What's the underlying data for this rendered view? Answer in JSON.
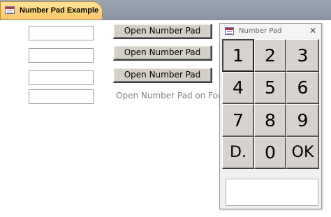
{
  "tab": {
    "title": "Number Pad Example",
    "icon": "form-icon"
  },
  "form": {
    "fields": [
      {
        "value": ""
      },
      {
        "value": ""
      },
      {
        "value": ""
      },
      {
        "value": ""
      }
    ],
    "buttons": [
      {
        "label": "Open Number Pad"
      },
      {
        "label": "Open Number Pad"
      },
      {
        "label": "Open Number Pad"
      }
    ],
    "focus_label": "Open Number Pad on Focus"
  },
  "numpad": {
    "title": "Number Pad",
    "icon": "form-icon",
    "close_glyph": "✕",
    "keys": [
      "1",
      "2",
      "3",
      "4",
      "5",
      "6",
      "7",
      "8",
      "9",
      "D.",
      "0",
      "OK"
    ],
    "selected_key": "1",
    "display_value": ""
  },
  "colors": {
    "tab_accent": "#f7c764",
    "tab_bar": "#9da6b3",
    "button_face": "#d4d0c8",
    "key_face": "#d6d3ce",
    "label_gray": "#808080"
  }
}
